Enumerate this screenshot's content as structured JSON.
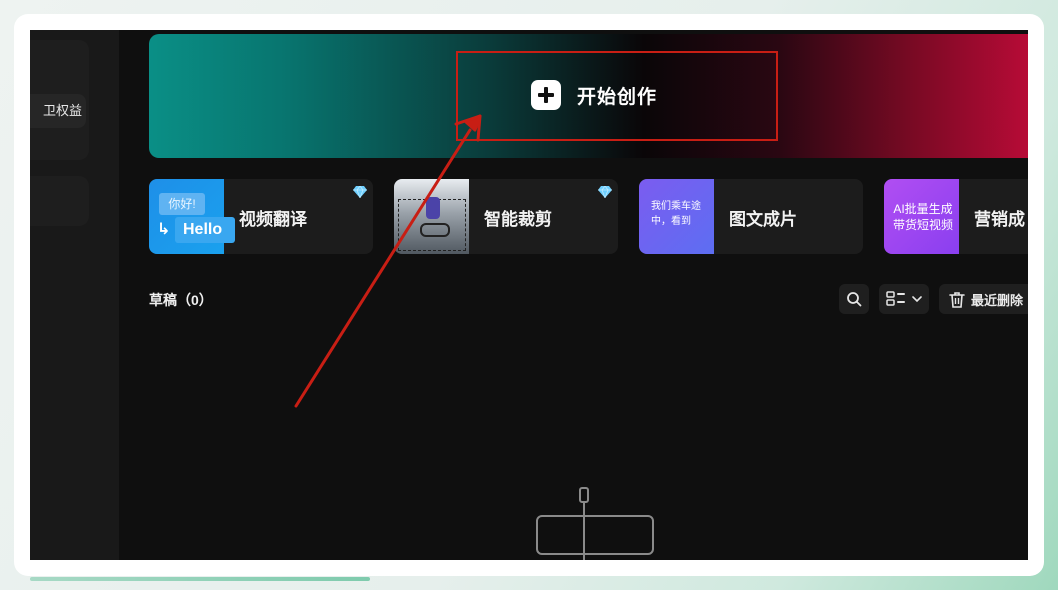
{
  "sidebar": {
    "benefit_label": "卫权益"
  },
  "hero": {
    "label": "开始创作",
    "icon": "plus-icon"
  },
  "tools": [
    {
      "name": "视频翻译",
      "premium": true,
      "thumb_text_1": "你好!",
      "thumb_text_2": "Hello"
    },
    {
      "name": "智能裁剪",
      "premium": true
    },
    {
      "name": "图文成片",
      "premium": false,
      "thumb_text": "我们乘车途中，看到"
    },
    {
      "name": "营销成",
      "premium": false,
      "thumb_text": "AI批量生成带货短视频"
    }
  ],
  "drafts": {
    "title": "草稿（0）",
    "delete_label": "最近删除"
  },
  "colors": {
    "annotation": "#c81e14",
    "hero_left": "#0a8f86",
    "hero_right": "#c20b3a",
    "premium_gem": "#6fd0ff"
  },
  "progress": 0.34
}
